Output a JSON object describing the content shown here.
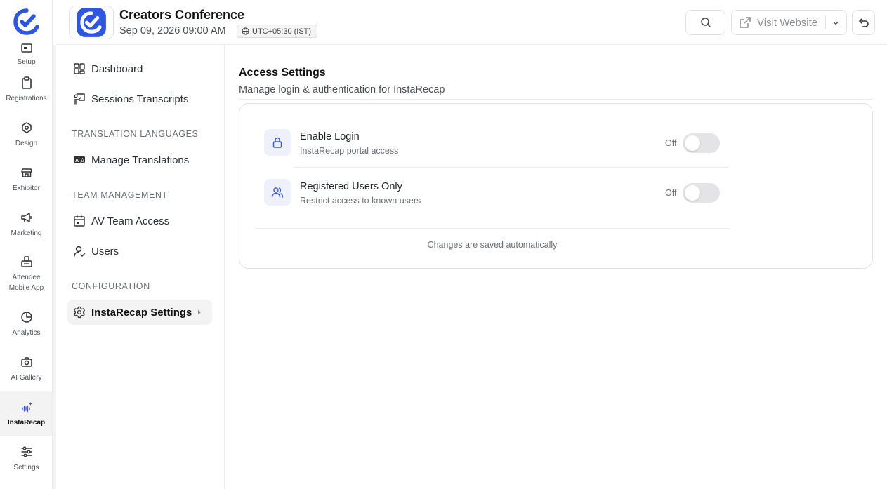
{
  "rail": {
    "items": [
      {
        "label": "Setup",
        "icon": "setup-icon"
      },
      {
        "label": "Registrations",
        "icon": "clipboard-icon"
      },
      {
        "label": "Design",
        "icon": "design-icon"
      },
      {
        "label": "Exhibitor",
        "icon": "store-icon"
      },
      {
        "label": "Marketing",
        "icon": "megaphone-icon"
      },
      {
        "label": "Attendee Mobile App",
        "icon": "mobile-app-icon"
      },
      {
        "label": "Analytics",
        "icon": "pie-chart-icon"
      },
      {
        "label": "AI Gallery",
        "icon": "camera-icon"
      },
      {
        "label": "InstaRecap",
        "icon": "sparkle-icon",
        "active": true
      },
      {
        "label": "Settings",
        "icon": "sliders-icon"
      }
    ]
  },
  "header": {
    "event_title": "Creators Conference",
    "event_date": "Sep 09, 2026 09:00 AM",
    "timezone": "UTC+05:30 (IST)",
    "visit_website_label": "Visit Website"
  },
  "subnav": {
    "items": [
      {
        "label": "Dashboard",
        "icon": "dashboard-icon"
      },
      {
        "label": "Sessions Transcripts",
        "icon": "presentation-icon"
      }
    ],
    "sections": [
      {
        "title": "TRANSLATION LANGUAGES",
        "items": [
          {
            "label": "Manage Translations",
            "icon": "translate-icon"
          }
        ]
      },
      {
        "title": "TEAM MANAGEMENT",
        "items": [
          {
            "label": "AV Team Access",
            "icon": "calendar-icon"
          },
          {
            "label": "Users",
            "icon": "user-icon"
          }
        ]
      },
      {
        "title": "CONFIGURATION",
        "items": [
          {
            "label": "InstaRecap Settings",
            "icon": "gear-icon",
            "active": true
          }
        ]
      }
    ]
  },
  "main": {
    "title": "Access Settings",
    "subtitle": "Manage login & authentication for InstaRecap",
    "settings": [
      {
        "title": "Enable Login",
        "description": "InstaRecap portal access",
        "state": "Off",
        "icon": "lock-icon",
        "enabled": false
      },
      {
        "title": "Registered Users Only",
        "description": "Restrict access to known users",
        "state": "Off",
        "icon": "users-icon",
        "enabled": false
      }
    ],
    "footer_note": "Changes are saved automatically"
  },
  "colors": {
    "brand": "#2f56e0",
    "icon_bg": "#eef1fb",
    "toggle_off": "#e4e4e7",
    "active_bg": "#f3f3f4"
  }
}
